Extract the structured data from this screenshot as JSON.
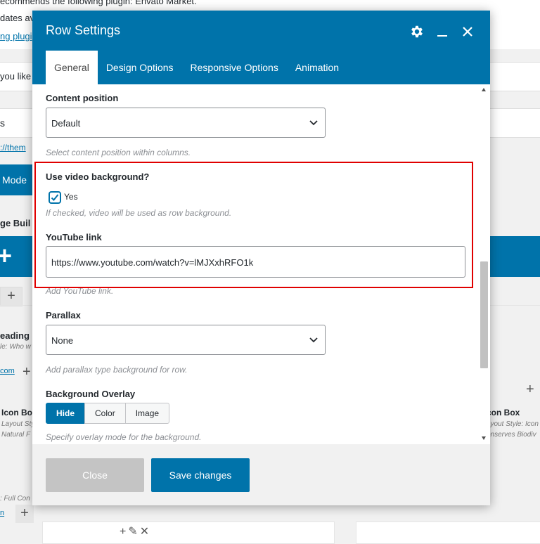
{
  "background": {
    "notice_line1": "ecommends the following plugin: Envato Market.",
    "notice_line2": "dates av",
    "notice_link": "ng plugi",
    "strip_text": "you like",
    "section_text": "s",
    "theme_link": "://them",
    "mode_button": "Mode",
    "page_builder": "ge Buil",
    "heading_label": "eading",
    "style_label": "le: Who w",
    "com_link": "com",
    "iconbox_left": "Icon Bo",
    "layout_style_left": "Layout Sty",
    "natural_left": "Natural F",
    "iconbox_right": "con Box",
    "layout_style_right": "ayout Style: Icon",
    "conserves_right": "onserves Biodiv",
    "full_label": ": Full  Con",
    "n_link": "n"
  },
  "modal": {
    "title": "Row Settings",
    "tabs": [
      {
        "label": "General",
        "active": true
      },
      {
        "label": "Design Options",
        "active": false
      },
      {
        "label": "Responsive Options",
        "active": false
      },
      {
        "label": "Animation",
        "active": false
      }
    ],
    "content_position": {
      "label": "Content position",
      "value": "Default",
      "help": "Select content position within columns."
    },
    "video_background": {
      "label": "Use video background?",
      "checked": true,
      "option_label": "Yes",
      "help": "If checked, video will be used as row background."
    },
    "youtube": {
      "label": "YouTube link",
      "value": "https://www.youtube.com/watch?v=lMJXxhRFO1k",
      "help": "Add YouTube link."
    },
    "parallax": {
      "label": "Parallax",
      "value": "None",
      "help": "Add parallax type background for row."
    },
    "overlay": {
      "label": "Background Overlay",
      "options": [
        "Hide",
        "Color",
        "Image"
      ],
      "selected": "Hide",
      "help": "Specify overlay mode for the background."
    },
    "footer": {
      "close_label": "Close",
      "save_label": "Save changes"
    }
  },
  "colors": {
    "primary": "#0073aa",
    "highlight": "#e00000",
    "disabled": "#c4c4c4"
  },
  "icons": [
    "gear-icon",
    "minimize-icon",
    "close-icon",
    "chevron-down-icon",
    "checkmark-icon",
    "plus-icon",
    "pencil-icon"
  ]
}
